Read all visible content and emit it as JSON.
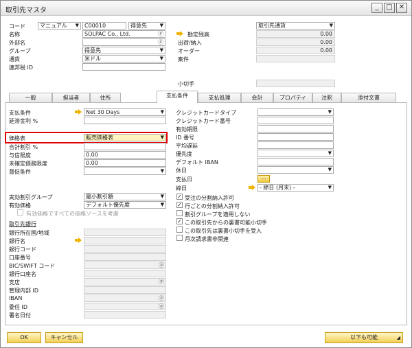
{
  "window": {
    "title": "取引先マスタ"
  },
  "header": {
    "code_label": "コード",
    "series": "マニュアル",
    "code_value": "C00010",
    "type_value": "得意先",
    "name_label": "名称",
    "name_value": "SOLPAC Co., Ltd.",
    "foreign_name_label": "外部名",
    "group_label": "グループ",
    "group_value": "得意先",
    "currency_label": "通貨",
    "currency_value": "米ドル",
    "fed_tax_label": "連邦税 ID",
    "right_dropdown": "取引先通貨",
    "balance_label": "勘定残高",
    "balance_value": "0.00",
    "deliveries_label": "出荷/納入",
    "deliveries_value": "0.00",
    "orders_label": "オーダー",
    "orders_value": "0.00",
    "opportunities_label": "案件",
    "checks_label": "小切手"
  },
  "tabs": [
    "一般",
    "担当者",
    "住所",
    "支払条件",
    "支払処理",
    "会計",
    "プロパティ",
    "注釈",
    "添付文書"
  ],
  "left": {
    "payment_terms_label": "支払条件",
    "payment_terms_value": "Net 30 Days",
    "interest_label": "延滞金利 %",
    "price_list_label": "価格表",
    "price_list_value": "販売価格表",
    "total_discount_label": "合計割引 %",
    "credit_limit_label": "与信限度",
    "credit_limit_value": "0.00",
    "commitment_limit_label": "未確定債務限度",
    "commitment_limit_value": "0.00",
    "dunning_label": "督促条件",
    "discount_group_label": "実効割引グループ",
    "discount_group_value": "最小割引額",
    "effective_price_label": "有効価格",
    "effective_price_value": "デフォルト優先度",
    "effective_price_check": "有効価格ですべての価格ソースを考慮",
    "bank_section_label": "取引先銀行",
    "bank_country_label": "銀行所在国/地域",
    "bank_name_label": "銀行名",
    "bank_code_label": "銀行コード",
    "account_label": "口座番号",
    "bic_label": "BIC/SWIFT コード",
    "account_name_label": "銀行口座名",
    "branch_label": "支店",
    "internal_id_label": "管理内部 ID",
    "iban_label": "IBAN",
    "mandate_id_label": "委任 ID",
    "signature_date_label": "署名日付"
  },
  "right": {
    "card_type_label": "クレジットカードタイプ",
    "card_no_label": "クレジットカード番号",
    "expiry_label": "有効期限",
    "id_no_label": "ID 番号",
    "avg_delay_label": "平均遅延",
    "priority_label": "優先度",
    "default_iban_label": "デフォルト IBAN",
    "holidays_label": "休日",
    "payment_dates_label": "支払日",
    "payment_dates_button": "...",
    "closing_label": "締日",
    "closing_value": "- 締日 (月末) -",
    "checkboxes": [
      {
        "label": "受注の分割納入許可",
        "checked": true
      },
      {
        "label": "行ごとの分割納入許可",
        "checked": true
      },
      {
        "label": "割引グループを適用しない",
        "checked": false
      },
      {
        "label": "この取引先からの裏書可能小切手",
        "checked": true
      },
      {
        "label": "この取引先は裏書小切手を受入",
        "checked": false
      },
      {
        "label": "月次請求書非関連",
        "checked": false
      }
    ]
  },
  "footer": {
    "ok": "OK",
    "cancel": "キャンセル",
    "also_possible": "以下も可能"
  },
  "colors": {
    "highlight_border": "#e00000",
    "button_gold": "#f2cf55",
    "arrow": "#f0b400"
  },
  "icons": [
    "minimize-icon",
    "maximize-icon",
    "close-icon",
    "link-arrow-icon",
    "dropdown-icon"
  ]
}
